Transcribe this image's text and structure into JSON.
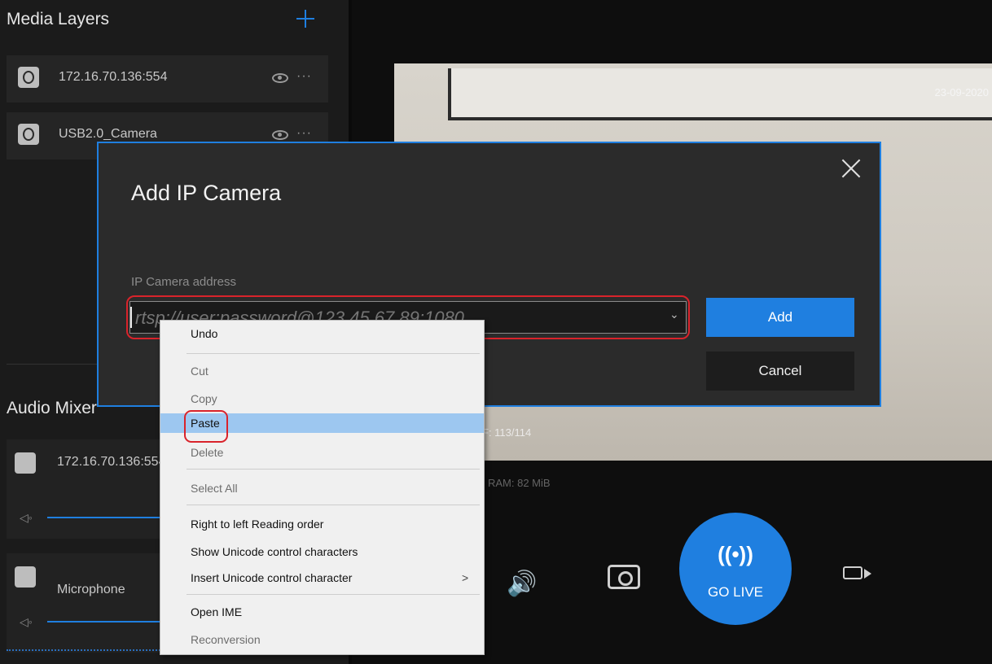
{
  "sidebar": {
    "media_title": "Media Layers",
    "layers": [
      {
        "label": "172.16.70.136:554",
        "icon": "ip-camera-icon"
      },
      {
        "label": "USB2.0_Camera",
        "icon": "webcam-icon"
      }
    ],
    "audio_title": "Audio Mixer",
    "mixers": [
      {
        "label": "172.16.70.136:554",
        "icon": "ip-audio-icon"
      },
      {
        "label": "Microphone",
        "icon": "microphone-icon"
      }
    ]
  },
  "preview": {
    "date_text": "23-09-2020",
    "stats_text": "F: 113/114",
    "ram_text": "| RAM: 82 MiB"
  },
  "dialog": {
    "title": "Add IP Camera",
    "field_label": "IP Camera address",
    "placeholder": "rtsp://user:password@123.45.67.89:1080",
    "add_label": "Add",
    "cancel_label": "Cancel"
  },
  "context_menu": {
    "items": [
      "Undo",
      "Cut",
      "Copy",
      "Paste",
      "Delete",
      "Select All",
      "Right to left Reading order",
      "Show Unicode control characters",
      "Insert Unicode control character",
      "Open IME",
      "Reconversion"
    ],
    "submenu_arrow": ">"
  },
  "controls": {
    "go_live_label": "GO LIVE",
    "broadcast_glyph": "((•))",
    "volume_glyph": "🔊"
  },
  "colors": {
    "accent": "#1f7fe0",
    "annotation": "#d9232b",
    "highlight": "#9dc7f0"
  }
}
